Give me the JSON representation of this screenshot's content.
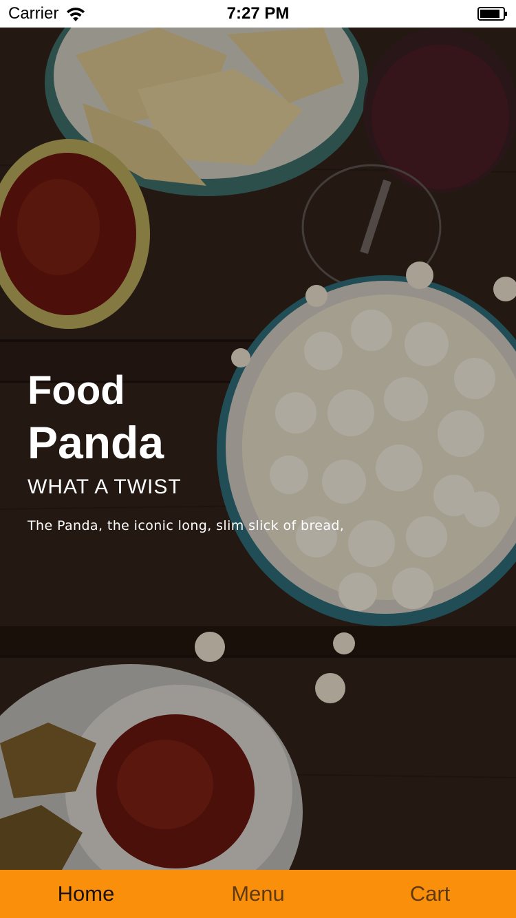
{
  "status_bar": {
    "carrier": "Carrier",
    "time": "7:27 PM",
    "icons": [
      "wifi-icon",
      "battery-icon"
    ]
  },
  "hero": {
    "title_line1": "Food",
    "title_line2": "Panda",
    "subtitle": "WHAT A TWIST",
    "description": "The Panda, the iconic long, slim slick of bread,"
  },
  "tab_bar": {
    "background": "#fa8f0c",
    "tabs": [
      {
        "label": "Home",
        "active": true
      },
      {
        "label": "Menu",
        "active": false
      },
      {
        "label": "Cart",
        "active": false
      }
    ]
  }
}
